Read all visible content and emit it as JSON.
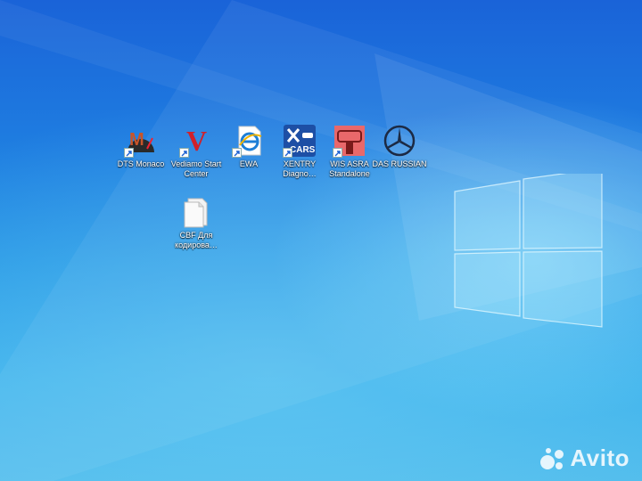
{
  "desktop": {
    "icons": [
      {
        "id": "dts-monaco",
        "label": "DTS Monaco",
        "icon": "dts-monaco-icon"
      },
      {
        "id": "vediamo",
        "label": "Vediamo Start Center",
        "icon": "vediamo-icon"
      },
      {
        "id": "ewa",
        "label": "EWA",
        "icon": "ewa-browser-icon"
      },
      {
        "id": "xentry",
        "label": "XENTRY Diagno…",
        "icon": "xentry-icon",
        "badge": "CARS"
      },
      {
        "id": "wis-asra",
        "label": "WIS ASRA Standalone",
        "icon": "wis-asra-icon"
      },
      {
        "id": "das",
        "label": "DAS RUSSIAN",
        "icon": "mercedes-star-icon"
      },
      {
        "id": "cbf",
        "label": "CBF Для кодирова…",
        "icon": "folder-icon"
      }
    ]
  },
  "watermark": {
    "text": "Avito"
  },
  "colors": {
    "background_top": "#1a63d8",
    "background_bottom": "#52bdec",
    "logo": "#bfefff"
  }
}
